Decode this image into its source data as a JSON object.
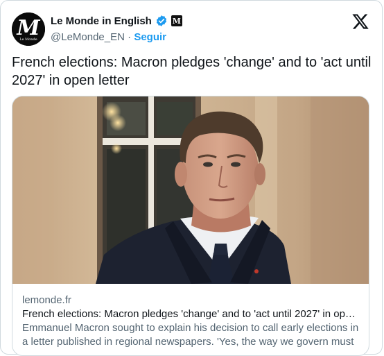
{
  "account": {
    "display_name": "Le Monde in English",
    "handle": "@LeMonde_EN",
    "separator": "·",
    "follow_label": "Seguir",
    "avatar_letters": "M",
    "avatar_caption": "Le Monde",
    "affiliate_badge_letter": "M"
  },
  "tweet": {
    "text": "French elections: Macron pledges 'change' and to 'act until 2027' in open letter"
  },
  "card": {
    "domain": "lemonde.fr",
    "title": "French elections: Macron pledges 'change' and to 'act until 2027' in ope…",
    "description": "Emmanuel Macron sought to explain his decision to call early elections in a letter published in regional newspapers. 'Yes, the way we govern must …"
  },
  "icons": {
    "verified": "verified-badge-icon",
    "affiliate": "affiliate-badge-icon",
    "platform": "x-logo-icon"
  },
  "colors": {
    "accent": "#1d9bf0",
    "secondary_text": "#536471",
    "border": "#cfd9de"
  }
}
